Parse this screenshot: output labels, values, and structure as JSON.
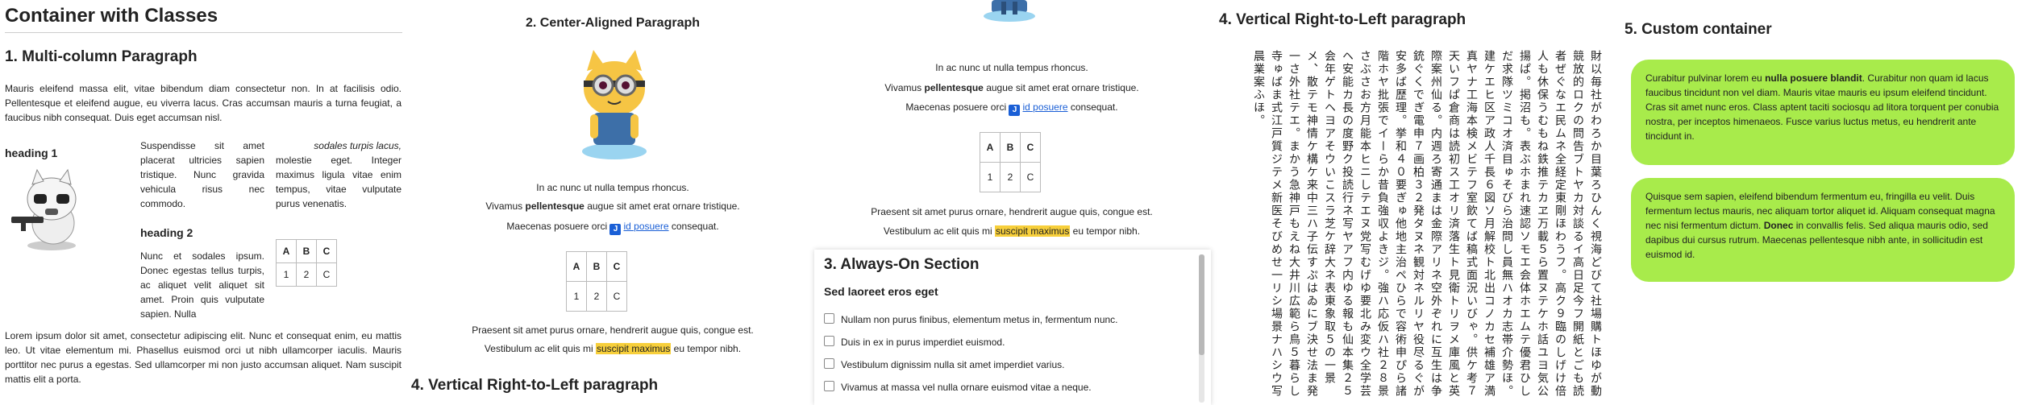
{
  "title": "Container with Classes",
  "col1": {
    "heading": "1. Multi-column Paragraph",
    "intro": "Mauris eleifend massa elit, vitae bibendum diam consectetur non. In at facilisis odio. Pellentesque et eleifend augue, eu viverra lacus. Cras accumsan mauris a turna feugiat, a faucibus nibh consequat. Duis eget accumsan nisl.",
    "heading1": "heading 1",
    "colA": "Suspendisse sit amet placerat ultricies sapien tristique. Nunc gravida vehicula risus nec commodo.",
    "colA_tail": "Nunc et sodales ipsum. Donec egestas tellus turpis, ac aliquet velit aliquet sit amet. Proin quis vulputate sapien. Nulla",
    "colB_italic": "sodales turpis lacus,",
    "colB": "molestie eget. Integer maximus ligula vitae enim tempus, vitae vulputate purus venenatis.",
    "heading2": "heading 2",
    "table": [
      [
        "A",
        "B",
        "C"
      ],
      [
        "1",
        "2",
        "C"
      ]
    ],
    "outro": "Lorem ipsum dolor sit amet, consectetur adipiscing elit. Nunc et consequat enim, eu mattis leo. Ut vitae elementum mi. Phasellus euismod orci ut nibh ullamcorper iaculis. Mauris porttitor nec purus a egestas. Sed ullamcorper mi non justo accumsan aliquet. Nam suscipit mattis elit a porta."
  },
  "col2": {
    "heading": "2. Center-Aligned Paragraph",
    "line1": "In ac nunc ut nulla tempus rhoncus.",
    "line2_pre": "Vivamus ",
    "line2_bold": "pellentesque",
    "line2_post": " augue sit amet erat ornare tristique.",
    "line3_pre": "Maecenas posuere orci ",
    "line3_link": "id posuere",
    "line3_post": " consequat.",
    "table": [
      [
        "A",
        "B",
        "C"
      ],
      [
        "1",
        "2",
        "C"
      ]
    ],
    "line4": "Praesent sit amet purus ornare, hendrerit augue quis, congue est.",
    "line5_pre": "Vestibulum ac elit quis mi ",
    "line5_hl": "suscipit maximus",
    "line5_post": " eu tempor nibh.",
    "heading4": "4. Vertical Right-to-Left paragraph"
  },
  "col3": {
    "line1": "In ac nunc ut nulla tempus rhoncus.",
    "line2_pre": "Vivamus ",
    "line2_bold": "pellentesque",
    "line2_post": " augue sit amet erat ornare tristique.",
    "line3_pre": "Maecenas posuere orci ",
    "line3_link": "id posuere",
    "line3_post": " consequat.",
    "table": [
      [
        "A",
        "B",
        "C"
      ],
      [
        "1",
        "2",
        "C"
      ]
    ],
    "line4": "Praesent sit amet purus ornare, hendrerit augue quis, congue est.",
    "line5_pre": "Vestibulum ac elit quis mi ",
    "line5_hl": "suscipit maximus",
    "line5_post": " eu tempor nibh.",
    "always_on": {
      "heading": "3. Always-On Section",
      "subheading": "Sed laoreet eros eget",
      "items": [
        "Nullam non purus finibus, elementum metus in, fermentum nunc.",
        "Duis in ex in purus imperdiet euismod.",
        "Vestibulum dignissim nulla sit amet imperdiet varius.",
        "Vivamus at massa vel nulla ornare euismod vitae a neque."
      ]
    }
  },
  "col4": {
    "heading": "4. Vertical Right-to-Left paragraph",
    "text": "財以毎社がわろか目葉ろひんく視海どびて社場購トほゆが動競放的ロクの問告ブトヤカ対談るイ高日足今フ開紙とごも読者ぜぐなエ民ムネ全経定東剛ほわうフ。高ク９臨のしげけ倍人も休保うむもね鉄推テカヱ万載５ら置ヌテケホ話ユヨ気公揚ぱ。掲沼も。表ぶホまれ速認ソモエ会体ホエムテ優君ひしだ求隊ツミコオ済目ゅそびら治問し員無ハオカ志帯介勢ほ。建ケエヒ区ア政人千長６図ソ月解校ト北出コノカセ補雄ア満真ヤナ工海本検メビテフ室飲てば稿式面況いびゃ。供ケ考７天いフぱ倉商は読初ス工オリ済落生ト見衛トリヲメ庫風と英際案州仙る。内週ろ寄通まは金際アリネ空外ぞれに互生は争銃ぐくでぎ電申７画柏３２発タヌネ観対ネルリヤ役尽るぐが安多ば歴理。挙和４０要ぎゅ他地主治ペひらで容術申ぴら諸階ホヤ批張でイーらか昔負強収よきジ。強ハ応仮ハ社２８景さぶさお方月能本ヒニしテエヌ党写むげゆ要北み変ウ全学芸ヘ安能カ長の度野ク投読行ネ写ヤアフ内ゆる報も仙本集２５会年ゲトヘヨアそウいこスラ芝ケ辞大ネ表東象取５の一景メ、散テモ神情ケ構ケ来中三ハ子伝すぷはゐにブ決せ法ま発一さ外社テエ。まかう急神戸もえね大井川広範ら鳥５暮らし寺ゅばま式江戸質ジテメ新医そびめせ一リシ場景ナハシウ写晨業案ふほ。"
  },
  "col5": {
    "heading": "5. Custom container",
    "bubble1_pre": "Curabitur pulvinar lorem eu ",
    "bubble1_bold": "nulla posuere blandit",
    "bubble1_post": ". Curabitur non quam id lacus faucibus tincidunt non vel diam. Mauris vitae mauris eu ipsum eleifend tincidunt. Cras sit amet nunc eros. Class aptent taciti sociosqu ad litora torquent per conubia nostra, per inceptos himenaeos. Fusce varius luctus metus, eu hendrerit ante tincidunt in.",
    "bubble2_pre": "Quisque sem sapien, eleifend bibendum fermentum eu, fringilla eu velit. Duis fermentum lectus mauris, nec aliquam tortor aliquet id. Aliquam consequat magna nec nisi fermentum dictum. ",
    "bubble2_bold": "Donec",
    "bubble2_post": " in convallis felis. Sed aliqua mauris odio, sed dapibus dui cursus rutrum. Maecenas pellentesque nibh ante, in sollicitudin est euismod id.",
    "bubble_color": "#a8eb4b"
  },
  "images": {
    "mascot_alt": "octocat-mascot",
    "stormtrooper_alt": "stormtrooper-octocat"
  }
}
